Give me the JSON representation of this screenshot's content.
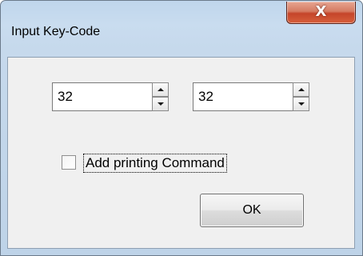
{
  "window": {
    "title": "Input Key-Code",
    "close_glyph": "X"
  },
  "spinners": [
    {
      "value": "32"
    },
    {
      "value": "32"
    }
  ],
  "checkbox": {
    "label": "Add printing Command",
    "checked": false
  },
  "buttons": {
    "ok_label": "OK"
  },
  "icons": {
    "close": "close-icon",
    "spin_up": "arrow-up-icon",
    "spin_down": "arrow-down-icon"
  },
  "colors": {
    "title_bar": "#c6d9ec",
    "client_area": "#f0f0f0",
    "close_button": "#c5452a"
  }
}
